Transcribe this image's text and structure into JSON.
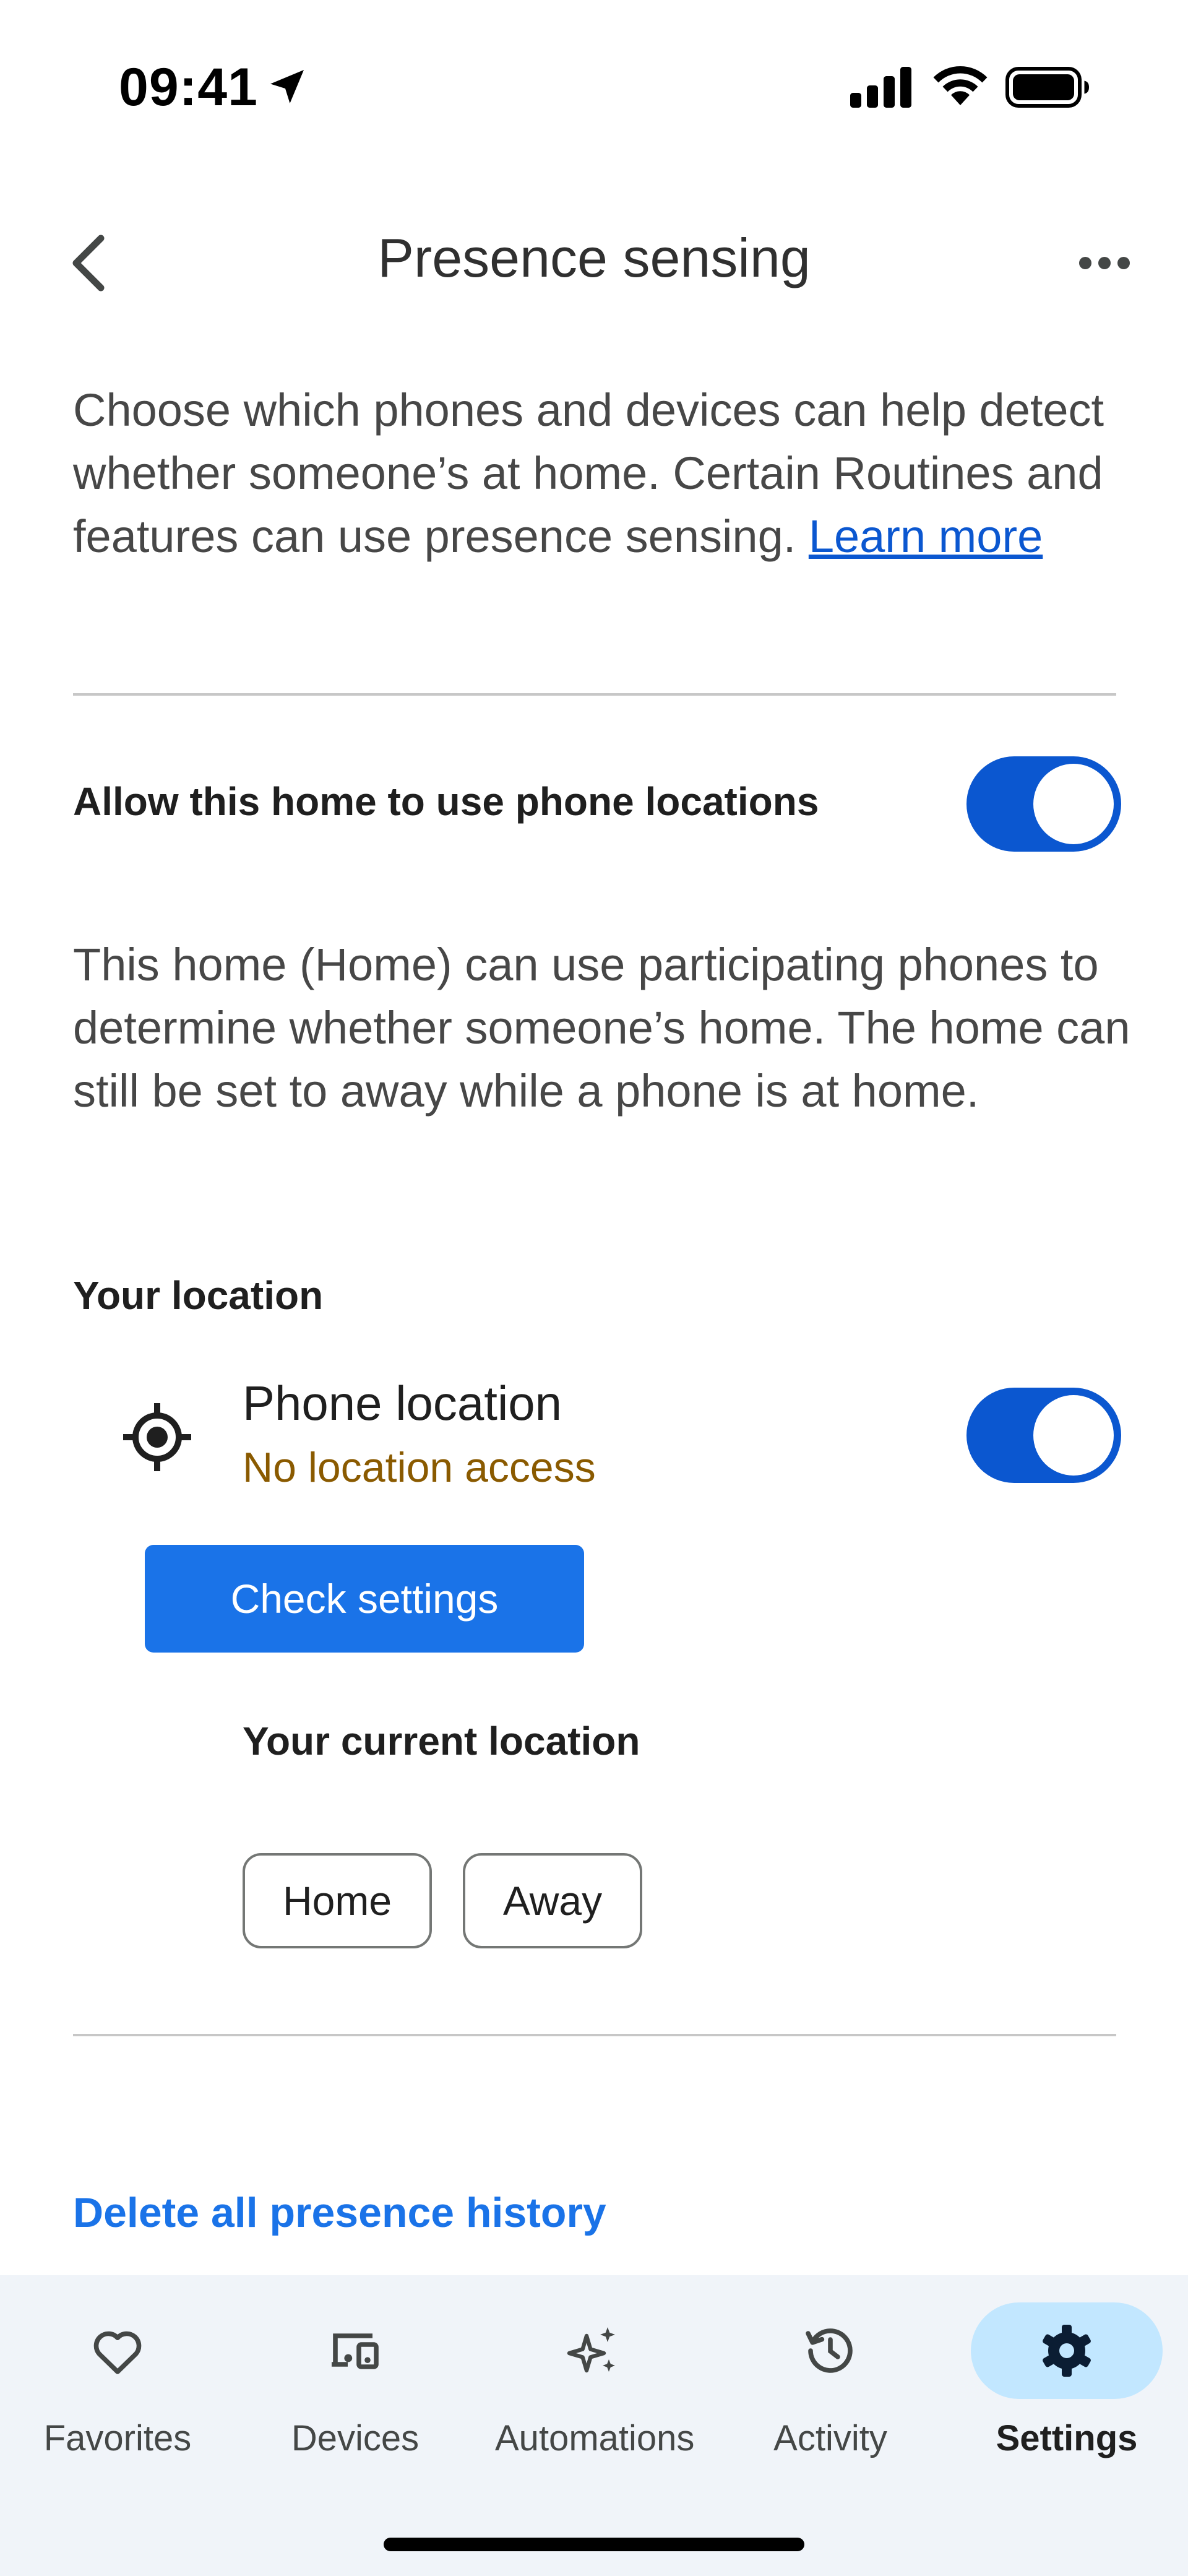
{
  "status_bar": {
    "time": "09:41"
  },
  "header": {
    "title": "Presence sensing",
    "back_icon": "chevron-left-icon",
    "more_icon": "more-horiz-icon"
  },
  "intro": {
    "text": "Choose which phones and devices can help detect whether someone’s at home. Certain Routines and features can use presence sensing. ",
    "learn_more": "Learn more"
  },
  "allow_phone_locations": {
    "label": "Allow this home to use phone locations",
    "enabled": true
  },
  "home_description": "This home (Home) can use participating phones to determine whether someone’s home. The home can still be set to away while a phone is at home.",
  "your_location": {
    "heading": "Your location",
    "phone_location_title": "Phone location",
    "phone_location_status": "No location access",
    "phone_location_enabled": true,
    "check_settings_button": "Check settings",
    "current_location_heading": "Your current location",
    "options": [
      "Home",
      "Away"
    ]
  },
  "delete_history_link": "Delete all presence history",
  "bottom_nav": {
    "items": [
      {
        "label": "Favorites",
        "icon": "heart-icon"
      },
      {
        "label": "Devices",
        "icon": "devices-icon"
      },
      {
        "label": "Automations",
        "icon": "sparkle-icon"
      },
      {
        "label": "Activity",
        "icon": "history-icon"
      },
      {
        "label": "Settings",
        "icon": "gear-icon",
        "active": true
      }
    ]
  },
  "colors": {
    "accent": "#0b57d0",
    "button": "#1a73e8",
    "warning_text": "#8a5a00",
    "nav_active_bg": "#c2e7ff"
  }
}
